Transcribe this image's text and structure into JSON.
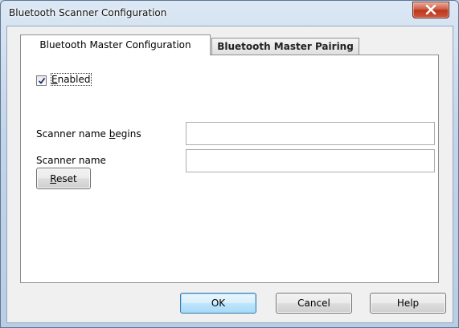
{
  "window": {
    "title": "Bluetooth Scanner Configuration"
  },
  "tabs": [
    {
      "label": "Bluetooth Master Configuration",
      "selected": true
    },
    {
      "label": "Bluetooth Master Pairing",
      "selected": false
    }
  ],
  "config": {
    "enabled": {
      "label_pre": "",
      "label_mnemonic": "E",
      "label_post": "nabled",
      "checked": true
    },
    "scanner_name_begins": {
      "label_pre": "Scanner name ",
      "label_mnemonic": "b",
      "label_post": "egins",
      "value": ""
    },
    "scanner_name": {
      "label": "Scanner name",
      "value": ""
    },
    "reset": {
      "label_mnemonic": "R",
      "label_post": "eset"
    }
  },
  "dialog_buttons": {
    "ok": "OK",
    "cancel": "Cancel",
    "help": "Help"
  },
  "icons": {
    "close": "close-icon",
    "checkmark": "checkmark-icon"
  }
}
